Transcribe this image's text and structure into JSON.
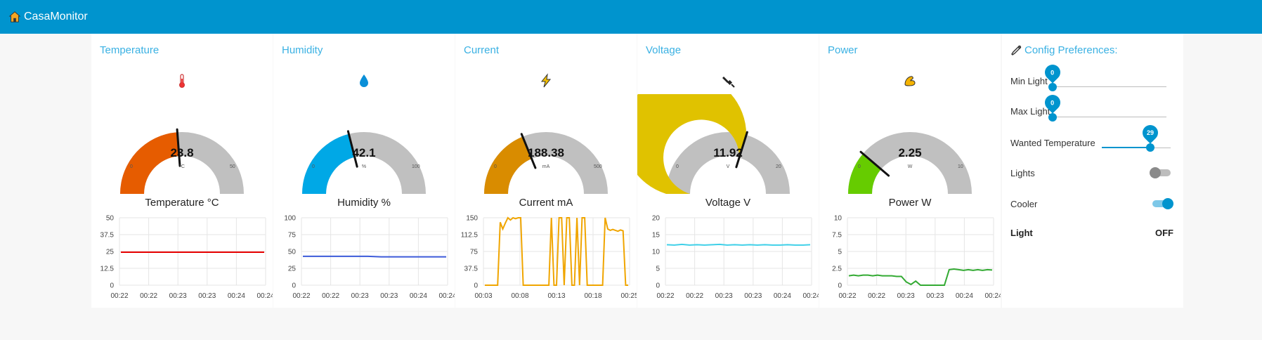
{
  "app": {
    "title": "CasaMonitor",
    "icon": "house-icon"
  },
  "colors": {
    "header": "#0094ce",
    "accent": "#3ab1e3",
    "gauge_bg": "#c0c0c0"
  },
  "cards": [
    {
      "key": "temperature",
      "title": "Temperature",
      "icon": "thermometer-icon",
      "gauge": {
        "value": "23.8",
        "numeric": 23.8,
        "min": "0",
        "max": "50",
        "min_num": 0,
        "max_num": 50,
        "unit": "°C",
        "color": "#e65c00"
      },
      "chart": {
        "title": "Temperature °C",
        "color": "#e60000",
        "y_ticks": [
          "50",
          "37.5",
          "25",
          "12.5",
          "0"
        ],
        "ylim": [
          0,
          50
        ],
        "x_ticks": [
          "00:22",
          "00:22",
          "00:23",
          "00:23",
          "00:24",
          "00:24"
        ],
        "values": [
          24.5,
          24.5,
          24.5,
          24.5,
          24.5,
          24.5,
          24.5,
          24.5,
          24.5,
          24.5
        ]
      }
    },
    {
      "key": "humidity",
      "title": "Humidity",
      "icon": "water-drop-icon",
      "gauge": {
        "value": "42.1",
        "numeric": 42.1,
        "min": "0",
        "max": "100",
        "min_num": 0,
        "max_num": 100,
        "unit": "%",
        "color": "#00a8e6"
      },
      "chart": {
        "title": "Humidity %",
        "color": "#3d5bd9",
        "y_ticks": [
          "100",
          "75",
          "50",
          "25",
          "0"
        ],
        "ylim": [
          0,
          100
        ],
        "x_ticks": [
          "00:22",
          "00:22",
          "00:23",
          "00:23",
          "00:24",
          "00:24"
        ],
        "values": [
          42.8,
          42.8,
          42.8,
          42.8,
          42.8,
          42.8,
          42.1,
          42.1,
          42.1,
          42.1,
          42.1,
          42.1
        ]
      }
    },
    {
      "key": "current",
      "title": "Current",
      "icon": "lightning-icon",
      "gauge": {
        "value": "188.38",
        "numeric": 188.38,
        "min": "0",
        "max": "500",
        "min_num": 0,
        "max_num": 500,
        "unit": "mA",
        "color": "#d98c00"
      },
      "chart": {
        "title": "Current mA",
        "color": "#f0a500",
        "y_ticks": [
          "150",
          "112.5",
          "75",
          "37.5",
          "0"
        ],
        "ylim": [
          0,
          150
        ],
        "x_ticks": [
          "00:03",
          "00:08",
          "00:13",
          "00:18",
          "00:25"
        ],
        "values": [
          0,
          0,
          0,
          0,
          0,
          0,
          140,
          125,
          138,
          150,
          145,
          150,
          148,
          150,
          150,
          0,
          0,
          0,
          0,
          0,
          0,
          0,
          0,
          0,
          0,
          0,
          150,
          0,
          0,
          150,
          150,
          0,
          150,
          150,
          0,
          0,
          150,
          0,
          150,
          150,
          0,
          0,
          0,
          0,
          0,
          0,
          0,
          150,
          125,
          122,
          124,
          122,
          120,
          123,
          121,
          0,
          0
        ]
      }
    },
    {
      "key": "voltage",
      "title": "Voltage",
      "icon": "plug-icon",
      "gauge": {
        "value": "11.92",
        "numeric": 11.92,
        "min": "0",
        "max": "20",
        "min_num": 0,
        "max_num": 20,
        "unit": "V",
        "color": "#e0c200"
      },
      "chart": {
        "title": "Voltage V",
        "color": "#40d0e8",
        "y_ticks": [
          "20",
          "15",
          "10",
          "5",
          "0"
        ],
        "ylim": [
          0,
          20
        ],
        "x_ticks": [
          "00:22",
          "00:22",
          "00:23",
          "00:23",
          "00:24",
          "00:24"
        ],
        "values": [
          12.0,
          11.9,
          12.1,
          11.9,
          12.0,
          11.9,
          12.0,
          12.1,
          11.9,
          12.0,
          11.9,
          12.0,
          11.9,
          12.0,
          11.9,
          11.9,
          12.0,
          11.9,
          11.9,
          12.0
        ]
      }
    },
    {
      "key": "power",
      "title": "Power",
      "icon": "muscle-icon",
      "gauge": {
        "value": "2.25",
        "numeric": 2.25,
        "min": "0",
        "max": "10",
        "min_num": 0,
        "max_num": 10,
        "unit": "W",
        "color": "#66cc00"
      },
      "chart": {
        "title": "Power W",
        "color": "#33aa33",
        "y_ticks": [
          "10",
          "7.5",
          "5",
          "2.5",
          "0"
        ],
        "ylim": [
          0,
          10
        ],
        "x_ticks": [
          "00:22",
          "00:22",
          "00:23",
          "00:23",
          "00:24",
          "00:24"
        ],
        "values": [
          1.4,
          1.5,
          1.4,
          1.5,
          1.5,
          1.4,
          1.5,
          1.4,
          1.4,
          1.4,
          1.3,
          1.3,
          0.5,
          0.1,
          0.6,
          0.0,
          0.0,
          0.0,
          0.0,
          0.0,
          0.0,
          2.3,
          2.4,
          2.3,
          2.2,
          2.3,
          2.2,
          2.3,
          2.2,
          2.3,
          2.25
        ]
      }
    }
  ],
  "config": {
    "title": "Config Preferences:",
    "icon": "wrench-icon",
    "min_light": {
      "label": "Min Light",
      "value": "0",
      "fraction": 0.0
    },
    "max_light": {
      "label": "Max Light",
      "value": "0",
      "fraction": 0.0
    },
    "wanted_temperature": {
      "label": "Wanted Temperature",
      "value": "29",
      "fraction": 0.7
    },
    "lights": {
      "label": "Lights",
      "on": false
    },
    "cooler": {
      "label": "Cooler",
      "on": true
    },
    "light_status": {
      "label": "Light",
      "value": "OFF"
    }
  }
}
